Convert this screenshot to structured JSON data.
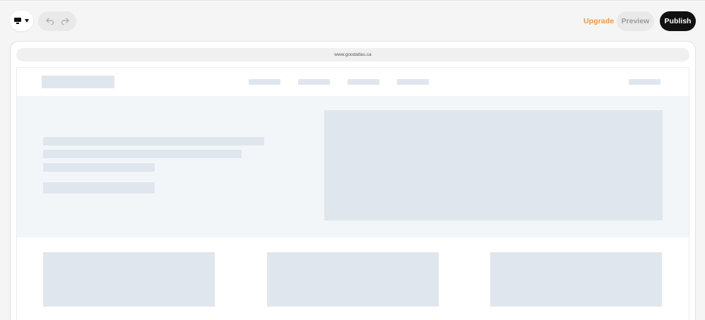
{
  "toolbar": {
    "device_icon": "monitor-icon",
    "device_caret_icon": "caret-down-icon",
    "undo_icon": "undo-icon",
    "redo_icon": "redo-icon",
    "upgrade_label": "Upgrade",
    "preview_label": "Preview",
    "publish_label": "Publish"
  },
  "browser": {
    "url": "www.goodatlas.ca"
  },
  "colors": {
    "accent": "#ee9a3a",
    "publish_bg": "#111111",
    "skeleton": "#e0e6ed",
    "hero_bg": "#f3f6f9"
  }
}
